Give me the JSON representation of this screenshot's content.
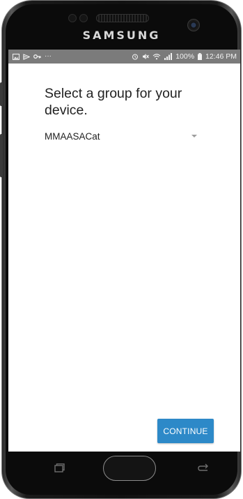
{
  "device": {
    "brand": "SAMSUNG"
  },
  "status_bar": {
    "left_icons": [
      "gallery-icon",
      "cast-icon",
      "key-icon",
      "more-icon"
    ],
    "right_icons": [
      "alarm-icon",
      "mute-icon",
      "wifi-icon",
      "signal-icon",
      "battery-icon"
    ],
    "more_glyph": "···",
    "battery_percent": "100%",
    "time": "12:46 PM"
  },
  "main": {
    "prompt": "Select a group for your device.",
    "group_select": {
      "selected_value": "MMAASACat"
    },
    "continue_label": "CONTINUE"
  },
  "colors": {
    "status_bar_bg": "#7b7b7b",
    "accent": "#2d89c8",
    "screen_bg": "#ffffff"
  }
}
